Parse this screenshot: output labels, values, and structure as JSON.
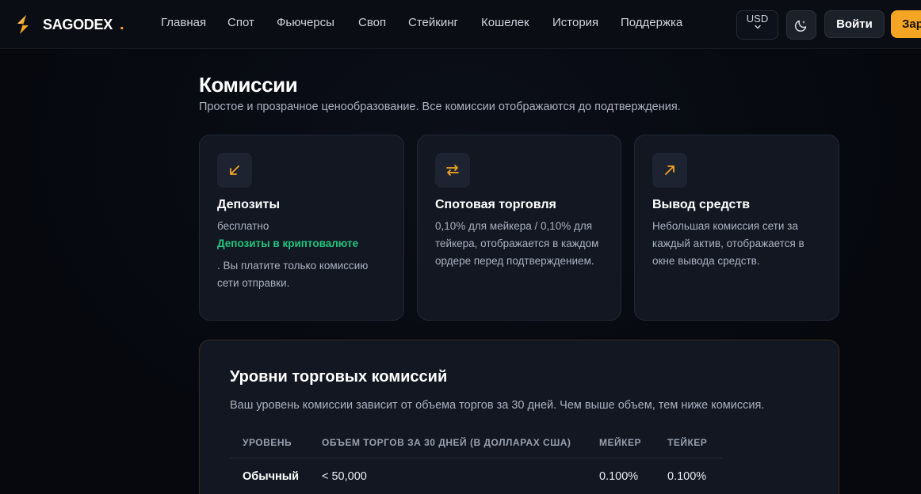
{
  "header": {
    "brand": "SAGODEX",
    "brand_dot": ".",
    "nav": [
      "Главная",
      "Спот",
      "Фьючерсы",
      "Своп",
      "Стейкинг",
      "Кошелек",
      "История",
      "Поддержка"
    ],
    "currency": "USD",
    "login_label": "Войти",
    "register_label": "Зар"
  },
  "page": {
    "title": "Комиссии",
    "subtitle": "Простое и прозрачное ценообразование. Все комиссии отображаются до подтверждения."
  },
  "cards": [
    {
      "icon": "arrow-down-left-icon",
      "title": "Депозиты",
      "text": "бесплатно",
      "accent": "Депозиты в криптовалюте",
      "after": ". Вы платите только комиссию сети отправки."
    },
    {
      "icon": "swap-arrows-icon",
      "title": "Спотовая торговля",
      "text": "0,10% для мейкера / 0,10% для тейкера, отображается в каждом ордере перед подтверждением."
    },
    {
      "icon": "arrow-up-right-icon",
      "title": "Вывод средств",
      "text": "Небольшая комиссия сети за каждый актив, отображается в окне вывода средств."
    }
  ],
  "tiers": {
    "title": "Уровни торговых комиссий",
    "subtitle": "Ваш уровень комиссии зависит от объема торгов за 30 дней. Чем выше объем, тем ниже комиссия.",
    "columns": [
      "УРОВЕНЬ",
      "ОБЪЕМ ТОРГОВ ЗА 30 ДНЕЙ (В ДОЛЛАРАХ США)",
      "МЕЙКЕР",
      "ТЕЙКЕР"
    ],
    "rows": [
      [
        "Обычный",
        "< 50,000",
        "0.100%",
        "0.100%"
      ]
    ]
  },
  "colors": {
    "accent": "#f5a524",
    "green": "#1fc77e",
    "background": "#070a11",
    "card": "#121722"
  }
}
